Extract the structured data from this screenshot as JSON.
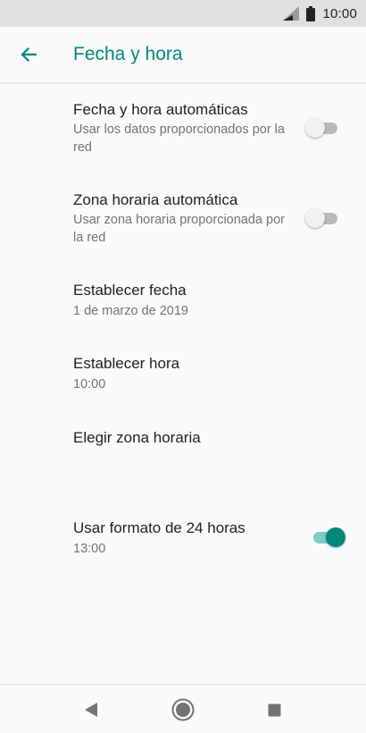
{
  "status_bar": {
    "time": "10:00",
    "icons": [
      "signal-icon",
      "battery-icon"
    ]
  },
  "app_bar": {
    "title": "Fecha y hora",
    "back_icon": "arrow-back-icon"
  },
  "colors": {
    "accent": "#00897b",
    "accent_light": "#80cbc4",
    "switch_off_track": "#b9b9b9",
    "switch_off_thumb": "#f1f1f1",
    "text_primary": "#212121",
    "text_secondary": "#737373"
  },
  "settings": [
    {
      "title": "Fecha y hora automáticas",
      "summary": "Usar los datos proporcionados por la red",
      "switch": "off"
    },
    {
      "title": "Zona horaria automática",
      "summary": "Usar zona horaria proporcionada por la red",
      "switch": "off"
    },
    {
      "title": "Establecer fecha",
      "summary": "1 de marzo de 2019"
    },
    {
      "title": "Establecer hora",
      "summary": "10:00"
    },
    {
      "title": "Elegir zona horaria",
      "summary": ""
    },
    {
      "title": "Usar formato de 24 horas",
      "summary": "13:00",
      "switch": "on"
    }
  ],
  "nav_bar": {
    "buttons": [
      "back-triangle-icon",
      "home-circle-icon",
      "recents-square-icon"
    ]
  }
}
